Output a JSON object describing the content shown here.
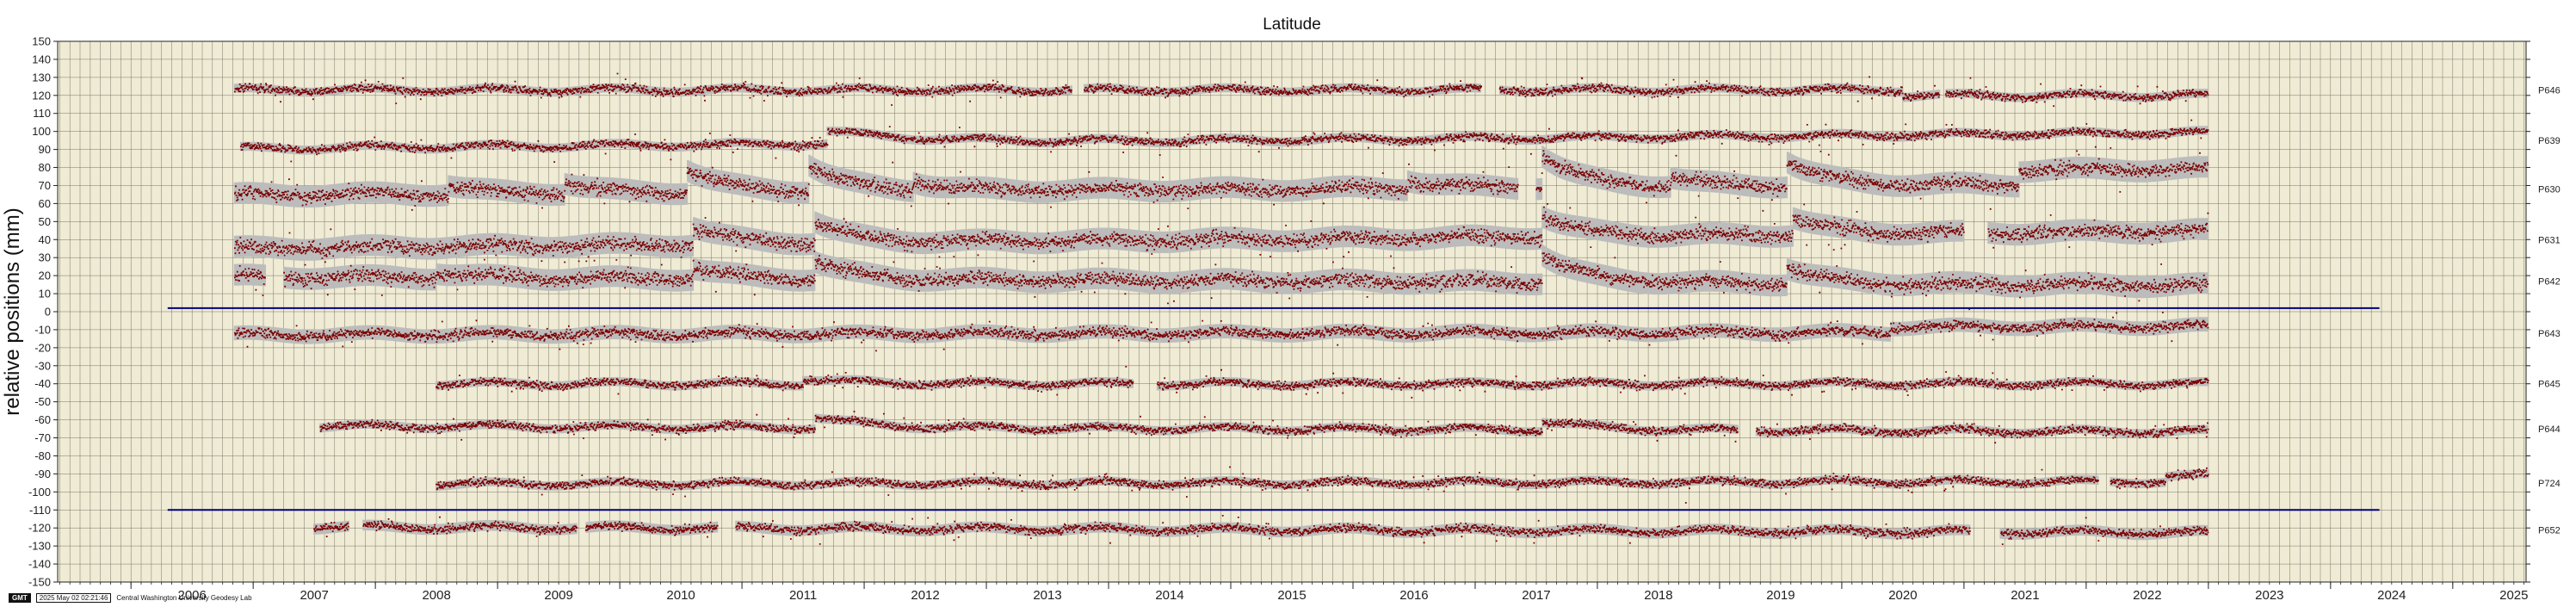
{
  "chart_data": {
    "type": "scatter",
    "title": "Latitude",
    "ylabel": "relative positions (mm)",
    "xlabel": "",
    "xlim": [
      2005.4,
      2025.6
    ],
    "ylim": [
      -150,
      150
    ],
    "ystep": 10,
    "x_ticks": [
      2006,
      2007,
      2008,
      2009,
      2010,
      2011,
      2012,
      2013,
      2014,
      2015,
      2016,
      2017,
      2018,
      2019,
      2020,
      2021,
      2022,
      2023,
      2024,
      2025
    ],
    "grid": true,
    "reference_lines": [
      {
        "y": 2,
        "x0": 2006.3,
        "x1": 2024.4
      },
      {
        "y": -110,
        "x0": 2006.3,
        "x1": 2024.4
      }
    ],
    "series": [
      {
        "name": "P646",
        "offset": 123,
        "x_range": [
          2006.85,
          2023.0
        ],
        "gaps": [
          [
            2013.7,
            2013.8
          ],
          [
            2017.05,
            2017.2
          ],
          [
            2020.8,
            2020.85
          ]
        ],
        "bumps": [],
        "jumps": [
          {
            "x": 2020.5,
            "dy": -3
          }
        ],
        "trend": 0,
        "noise": 1.5,
        "band": 2.5
      },
      {
        "name": "P639",
        "offset": 95,
        "x_range": [
          2006.9,
          2023.0
        ],
        "gaps": [],
        "bumps": [
          {
            "x": 2011.7,
            "h": 7,
            "w": 0.8
          }
        ],
        "jumps": [],
        "trend": 0.55,
        "noise": 1.5,
        "band": 2.5
      },
      {
        "name": "P630",
        "offset": 68,
        "x_range": [
          2006.85,
          2023.0
        ],
        "gaps": [
          [
            2017.35,
            2017.5
          ]
        ],
        "bumps": [
          {
            "x": 2008.6,
            "h": 5,
            "w": 0.25
          },
          {
            "x": 2009.55,
            "h": 6,
            "w": 0.25
          },
          {
            "x": 2010.55,
            "h": 13,
            "w": 0.3
          },
          {
            "x": 2011.55,
            "h": 15,
            "w": 0.3
          },
          {
            "x": 2012.4,
            "h": 5,
            "w": 0.25
          },
          {
            "x": 2016.45,
            "h": 5,
            "w": 0.25
          },
          {
            "x": 2017.55,
            "h": 18,
            "w": 0.3
          },
          {
            "x": 2018.6,
            "h": 5,
            "w": 0.25
          },
          {
            "x": 2019.55,
            "h": 14,
            "w": 0.3
          }
        ],
        "jumps": [
          {
            "x": 2021.45,
            "dy": 8
          }
        ],
        "trend": 0.4,
        "noise": 2.5,
        "band": 6
      },
      {
        "name": "P631",
        "offset": 40,
        "x_range": [
          2006.85,
          2023.0
        ],
        "gaps": [
          [
            2021.0,
            2021.2
          ]
        ],
        "bumps": [
          {
            "x": 2010.6,
            "h": 10,
            "w": 0.3
          },
          {
            "x": 2011.6,
            "h": 12,
            "w": 0.3
          },
          {
            "x": 2017.55,
            "h": 12,
            "w": 0.3
          },
          {
            "x": 2019.6,
            "h": 10,
            "w": 0.3
          }
        ],
        "jumps": [],
        "trend": 0.6,
        "noise": 2.5,
        "band": 6
      },
      {
        "name": "P642",
        "offset": 17,
        "x_range": [
          2006.85,
          2023.0
        ],
        "gaps": [
          [
            2007.1,
            2007.25
          ]
        ],
        "bumps": [
          {
            "x": 2008.5,
            "h": 3,
            "w": 0.25
          },
          {
            "x": 2010.6,
            "h": 6,
            "w": 0.3
          },
          {
            "x": 2011.6,
            "h": 10,
            "w": 0.3
          },
          {
            "x": 2017.55,
            "h": 16,
            "w": 0.3
          },
          {
            "x": 2019.55,
            "h": 9,
            "w": 0.3
          }
        ],
        "jumps": [],
        "trend": -0.3,
        "noise": 2.5,
        "band": 6
      },
      {
        "name": "P643",
        "offset": -12,
        "x_range": [
          2006.85,
          2023.0
        ],
        "gaps": [],
        "bumps": [],
        "jumps": [
          {
            "x": 2020.4,
            "dy": 3
          }
        ],
        "trend": 0.1,
        "noise": 1.8,
        "band": 4
      },
      {
        "name": "P645",
        "offset": -40,
        "x_range": [
          2008.5,
          2023.0
        ],
        "gaps": [
          [
            2014.2,
            2014.4
          ]
        ],
        "bumps": [
          {
            "x": 2011.5,
            "h": 3,
            "w": 0.4
          }
        ],
        "jumps": [],
        "trend": 0,
        "noise": 1.5,
        "band": 2.5
      },
      {
        "name": "P644",
        "offset": -65,
        "x_range": [
          2007.55,
          2023.0
        ],
        "gaps": [
          [
            2019.15,
            2019.3
          ]
        ],
        "bumps": [
          {
            "x": 2011.6,
            "h": 6,
            "w": 0.4
          },
          {
            "x": 2017.55,
            "h": 5,
            "w": 0.4
          }
        ],
        "jumps": [],
        "trend": -0.2,
        "noise": 1.5,
        "band": 2.5
      },
      {
        "name": "P724",
        "offset": -95,
        "x_range": [
          2008.5,
          2023.0
        ],
        "gaps": [
          [
            2022.1,
            2022.2
          ]
        ],
        "bumps": [],
        "jumps": [
          {
            "x": 2022.65,
            "dy": 3
          }
        ],
        "trend": 0.1,
        "noise": 1.5,
        "band": 2.5
      },
      {
        "name": "P652",
        "offset": -121,
        "x_range": [
          2007.5,
          2023.0
        ],
        "gaps": [
          [
            2007.78,
            2007.9
          ],
          [
            2009.65,
            2009.72
          ],
          [
            2010.8,
            2010.95
          ],
          [
            2021.05,
            2021.3
          ]
        ],
        "bumps": [],
        "jumps": [],
        "trend": -0.2,
        "noise": 1.5,
        "band": 3
      }
    ]
  },
  "footer": {
    "badge": "GMT",
    "timestamp": "2025 May 02 02:21:46",
    "lab": "Central Washington University Geodesy Lab"
  },
  "colors": {
    "plot_bg": "#efebd4",
    "grid": "#6f6a5c",
    "points": "#7a0000",
    "band": "#bcbcbc",
    "reference_line": "#00007a"
  }
}
